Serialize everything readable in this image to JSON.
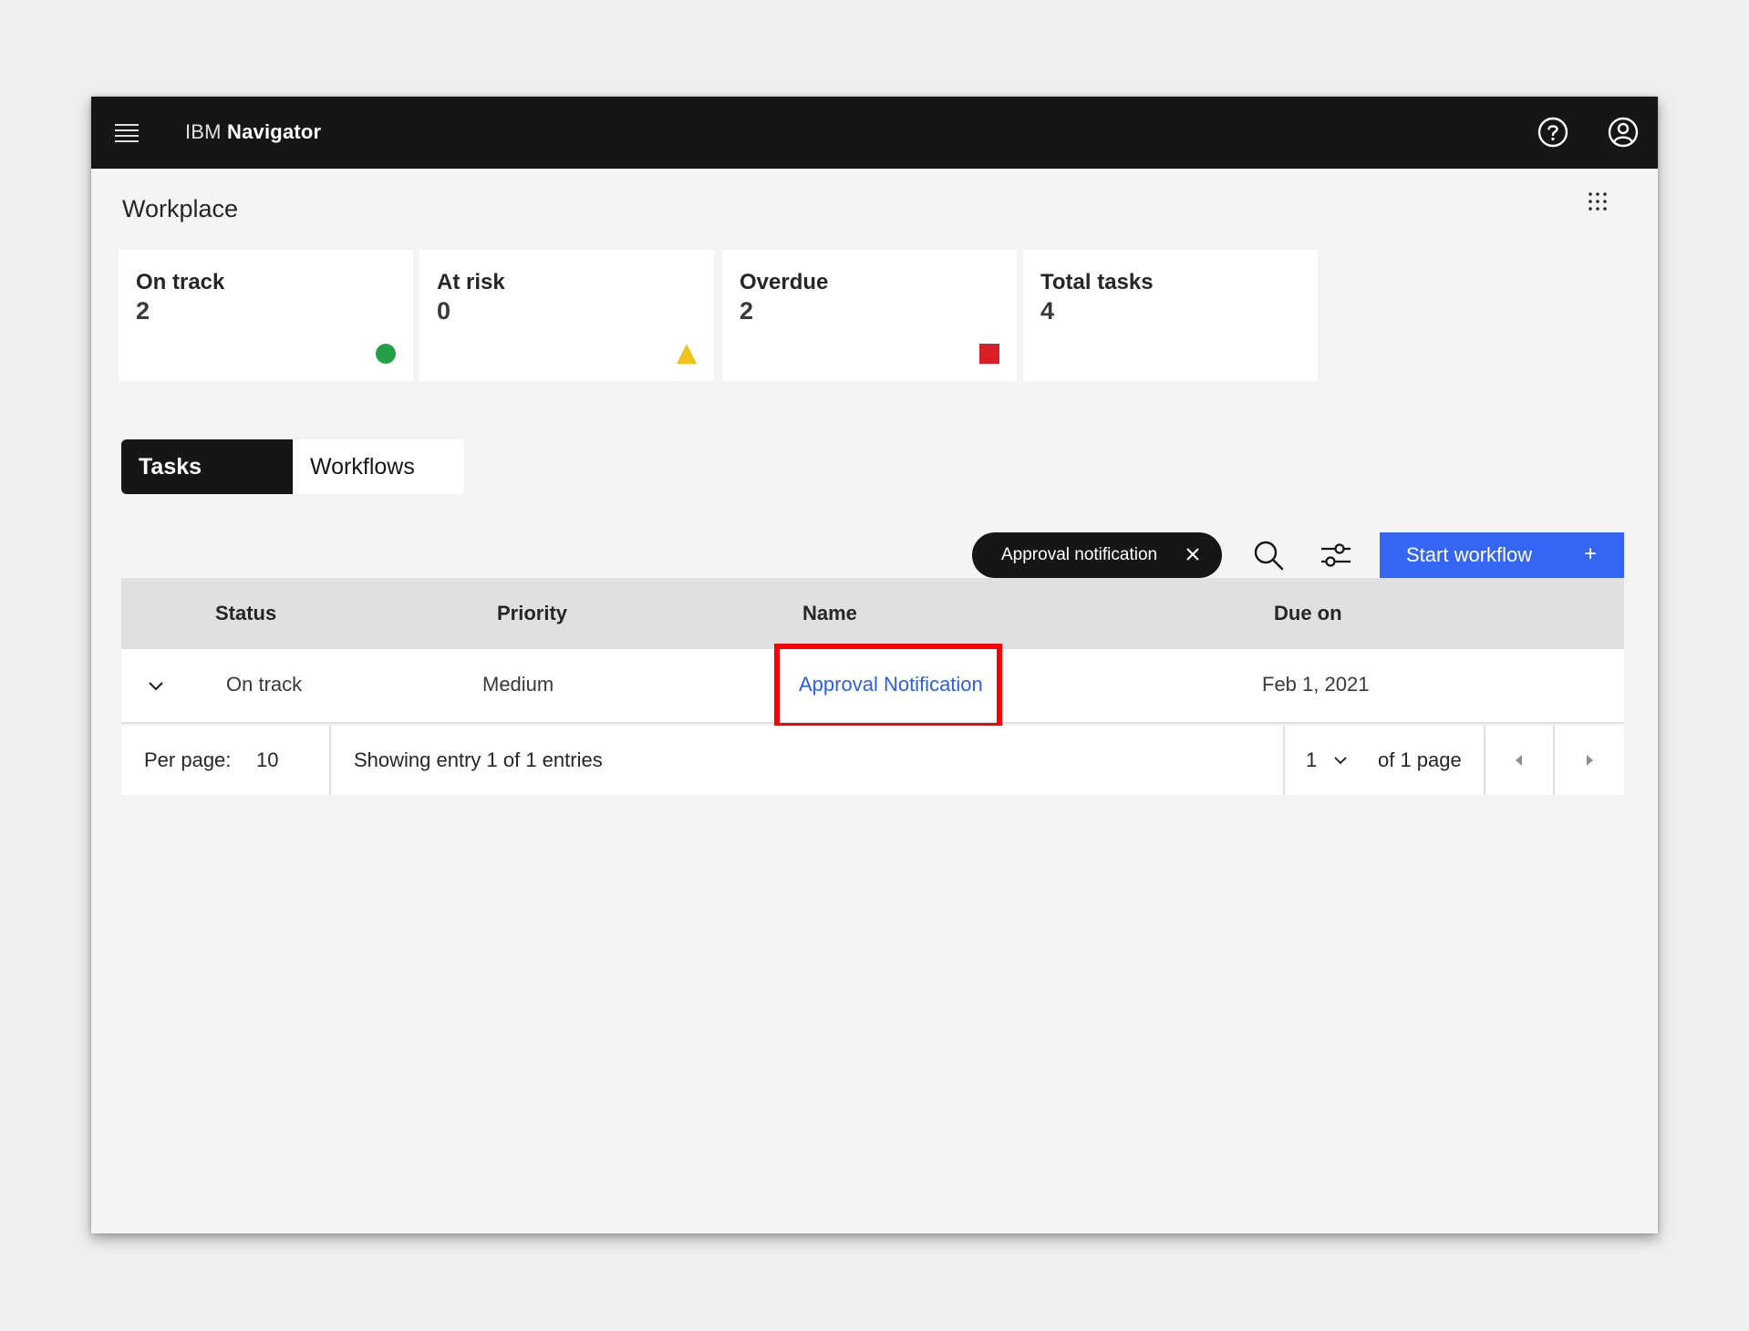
{
  "header": {
    "brand_prefix": "IBM",
    "brand_name": "Navigator"
  },
  "page": {
    "title": "Workplace"
  },
  "tiles": [
    {
      "label": "On track",
      "value": "2",
      "indicator": "green-circle",
      "color": "#24a148"
    },
    {
      "label": "At risk",
      "value": "0",
      "indicator": "yellow-triangle",
      "color": "#f1c21b"
    },
    {
      "label": "Overdue",
      "value": "2",
      "indicator": "red-square",
      "color": "#da1e28"
    },
    {
      "label": "Total tasks",
      "value": "4"
    }
  ],
  "tabs": [
    {
      "label": "Tasks",
      "selected": true
    },
    {
      "label": "Workflows",
      "selected": false
    }
  ],
  "toolbar": {
    "filter_tag": "Approval notification",
    "primary_button": "Start workflow",
    "primary_button_icon": "+"
  },
  "table": {
    "columns": [
      "Status",
      "Priority",
      "Name",
      "Due on"
    ],
    "rows": [
      {
        "status": "On track",
        "priority": "Medium",
        "name": "Approval Notification",
        "due": "Feb 1, 2021"
      }
    ]
  },
  "pagination": {
    "per_page_label": "Per page:",
    "per_page_value": "10",
    "summary": "Showing entry 1 of 1 entries",
    "current_page": "1",
    "total_pages_label": "of 1 page"
  },
  "colors": {
    "topbar": "#161616",
    "primary": "#3466f3",
    "link": "#2b5fe0",
    "highlight": "#ff0000"
  }
}
